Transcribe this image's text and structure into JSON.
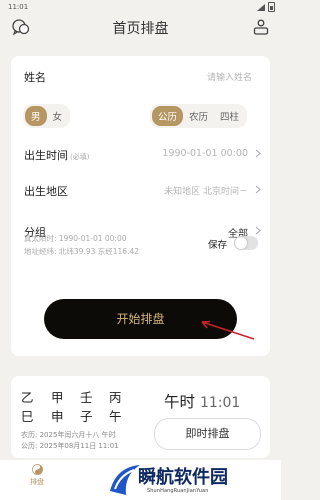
{
  "status": {
    "time": "11:01"
  },
  "header": {
    "title": "首页排盘"
  },
  "form": {
    "name_label": "姓名",
    "name_placeholder": "请输入姓名",
    "gender": {
      "male": "男",
      "female": "女"
    },
    "calendar": {
      "solar": "公历",
      "lunar": "农历",
      "pillars": "四柱"
    },
    "birth_time_label": "出生时间",
    "required_note": "(必填)",
    "birth_time_value": "1990-01-01 00:00",
    "birth_place_label": "出生地区",
    "birth_place_value": "未知地区 北京时间－",
    "group_label": "分组",
    "group_value": "全部",
    "true_solar_time": "真太阳时: 1990-01-01 00:00",
    "coordinates": "地址经纬: 北纬39.93 东经116.42",
    "save_label": "保存",
    "start_button": "开始排盘"
  },
  "now_card": {
    "stems": [
      "乙",
      "甲",
      "壬",
      "丙"
    ],
    "branches": [
      "巳",
      "申",
      "子",
      "午"
    ],
    "lunar_date": "农历: 2025年闰六月十八 午时",
    "solar_date": "公历: 2025年08月11日 11:01",
    "hour_name": "午时",
    "hour_time": "11:01",
    "now_button": "即时排盘"
  },
  "bottom_nav": {
    "paipan": "排盘"
  },
  "watermark": {
    "text": "瞬航软件园",
    "sub": "ShunHangRuanJianYuan"
  },
  "colors": {
    "accent": "#b69662",
    "button_bg": "#0d0b08",
    "button_text": "#d5b57a",
    "background": "#f3f1ee"
  }
}
